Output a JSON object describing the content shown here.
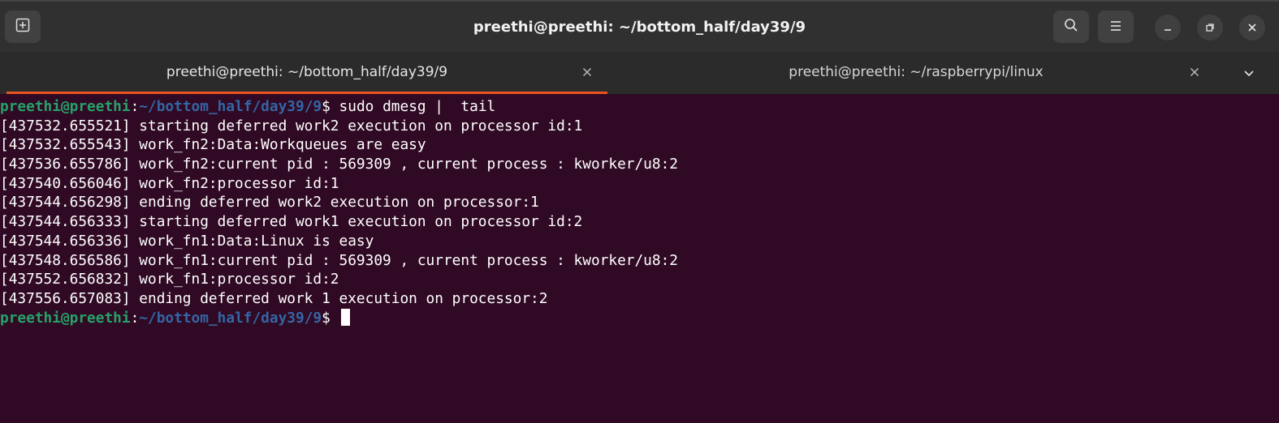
{
  "window": {
    "title": "preethi@preethi: ~/bottom_half/day39/9"
  },
  "headerbar": {
    "icons": [
      "new-tab-icon",
      "search-icon",
      "hamburger-menu-icon",
      "minimize-icon",
      "maximize-icon",
      "close-icon"
    ]
  },
  "tabs": [
    {
      "label": "preethi@preethi: ~/bottom_half/day39/9",
      "active": true
    },
    {
      "label": "preethi@preethi: ~/raspberrypi/linux",
      "active": false
    }
  ],
  "colors": {
    "terminal_bg": "#300a24",
    "prompt_user": "#26a269",
    "prompt_path": "#3465a4",
    "active_tab_underline": "#e95420"
  },
  "terminal": {
    "prompt_user": "preethi@preethi",
    "prompt_colon": ":",
    "prompt_path": "~/bottom_half/day39/9",
    "prompt_symbol": "$",
    "command": " sudo dmesg |  tail",
    "output": [
      "[437532.655521] starting deferred work2 execution on processor id:1",
      "[437532.655543] work_fn2:Data:Workqueues are easy",
      "[437536.655786] work_fn2:current pid : 569309 , current process : kworker/u8:2",
      "[437540.656046] work_fn2:processor id:1",
      "[437544.656298] ending deferred work2 execution on processor:1",
      "[437544.656333] starting deferred work1 execution on processor id:2",
      "[437544.656336] work_fn1:Data:Linux is easy",
      "[437548.656586] work_fn1:current pid : 569309 , current process : kworker/u8:2",
      "[437552.656832] work_fn1:processor id:2",
      "[437556.657083] ending deferred work 1 execution on processor:2"
    ]
  }
}
